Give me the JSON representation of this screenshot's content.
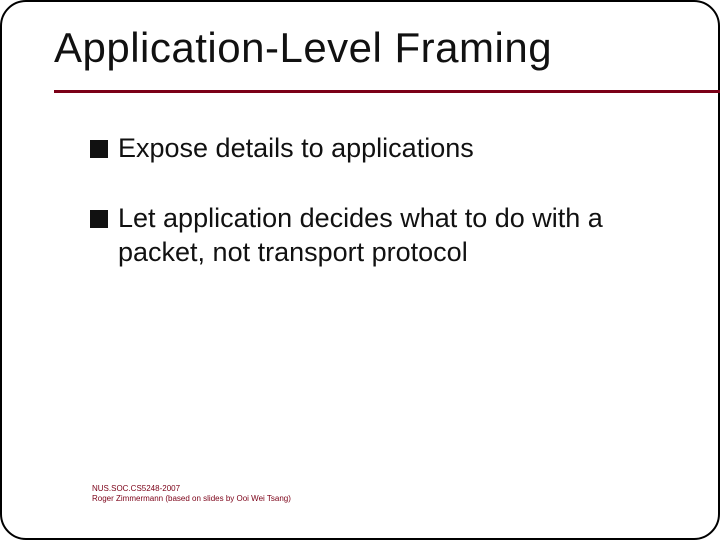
{
  "title": "Application-Level Framing",
  "bullets": [
    {
      "text": "Expose details to applications"
    },
    {
      "text": "Let application decides what to do with a packet, not transport protocol"
    }
  ],
  "footer": {
    "line1": "NUS.SOC.CS5248-2007",
    "line2": "Roger Zimmermann (based on slides by Ooi Wei Tsang)"
  },
  "colors": {
    "rule": "#7b0017",
    "text": "#111111",
    "footer": "#7b0017"
  }
}
